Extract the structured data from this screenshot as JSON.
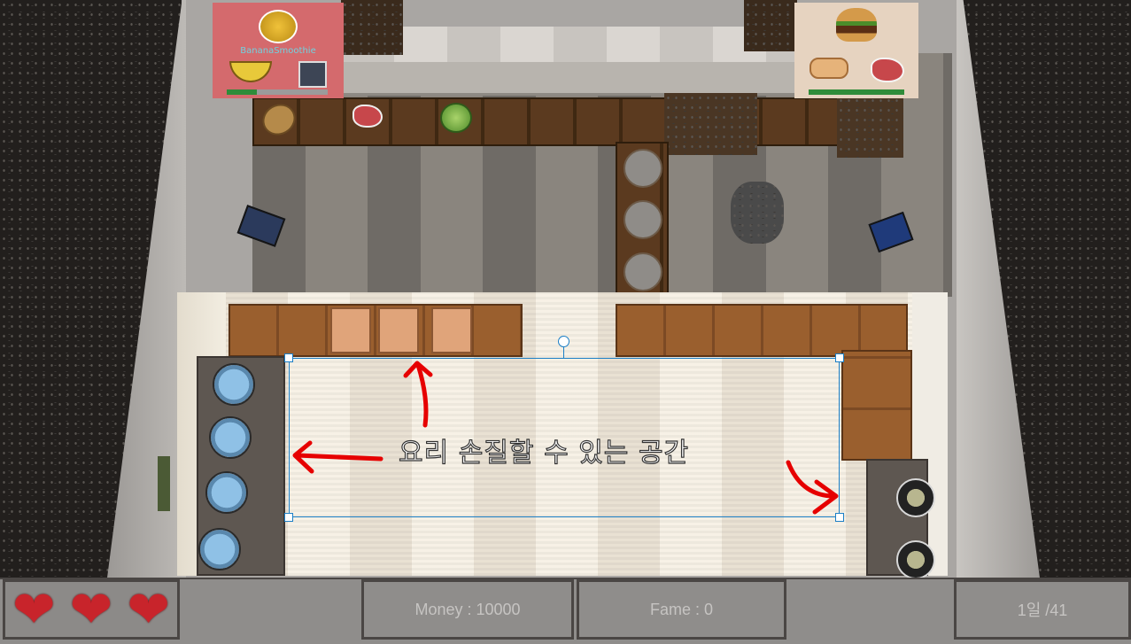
{
  "orders": {
    "left": {
      "dish_name": "BananaSmoothie",
      "dish_icon": "smoothie-cup-icon",
      "ingredients": [
        "banana-icon",
        "blender-icon"
      ]
    },
    "right": {
      "dish_name": "",
      "dish_icon": "hamburger-icon",
      "ingredients": [
        "bun-icon",
        "meat-icon"
      ]
    }
  },
  "ingredients_on_counter": [
    "potato-icon",
    "meat-icon",
    "lettuce-icon"
  ],
  "annotation": {
    "text": "요리 손질할 수 있는 공간",
    "color": "#e60000"
  },
  "hud": {
    "lives": 3,
    "heart_glyph": "❤",
    "money_label": "Money : 10000",
    "fame_label": "Fame : 0",
    "day_label": "1일 /41"
  },
  "colors": {
    "heart": "#c8242b",
    "selection": "#1c7fc6",
    "order_left_bg": "#d46a6d",
    "order_right_bg": "#e6d3c0"
  }
}
